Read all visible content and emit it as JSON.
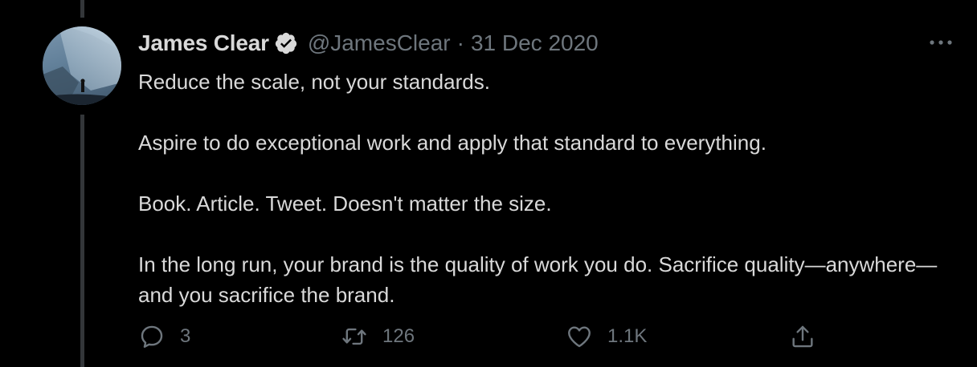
{
  "tweet": {
    "author": {
      "name": "James Clear",
      "handle": "@JamesClear",
      "verified": true
    },
    "separator": "·",
    "date": "31 Dec 2020",
    "paragraphs": [
      "Reduce the scale, not your standards.",
      "Aspire to do exceptional work and apply that standard to everything.",
      "Book. Article. Tweet. Doesn't matter the size.",
      "In the long run, your brand is the quality of work you do. Sacrifice quality—anywhere—and you sacrifice the brand."
    ],
    "stats": {
      "replies": "3",
      "retweets": "126",
      "likes": "1.1K"
    }
  },
  "icons": {
    "reply": "reply-icon",
    "retweet": "retweet-icon",
    "like": "like-icon",
    "share": "share-icon",
    "more": "more-icon",
    "verified": "verified-badge-icon"
  },
  "colors": {
    "background": "#000000",
    "primary_text": "#d9d9d9",
    "secondary_text": "#6e767d",
    "thread_line": "#333639",
    "verified_badge": "#d9d9d9"
  }
}
